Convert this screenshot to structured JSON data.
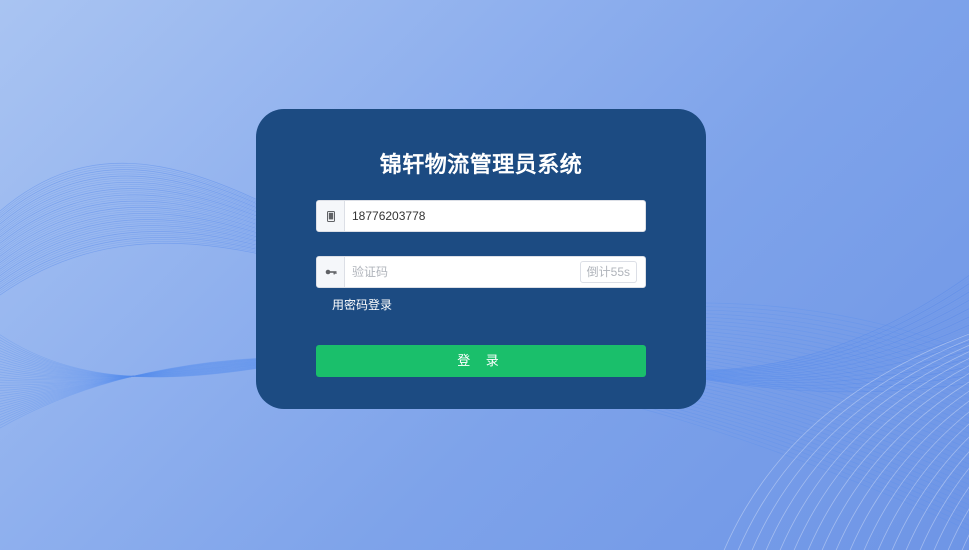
{
  "app": {
    "title": "锦轩物流管理员系统"
  },
  "form": {
    "phone": {
      "icon": "mobile-phone-icon",
      "value": "18776203778"
    },
    "code": {
      "icon": "key-icon",
      "placeholder": "验证码",
      "countdown_label": "倒计55s"
    },
    "password_login_link": "用密码登录",
    "login_button": "登 录"
  },
  "colors": {
    "card": "#1c4b82",
    "login_button": "#1abf6b",
    "background": "#8fb0ee"
  }
}
